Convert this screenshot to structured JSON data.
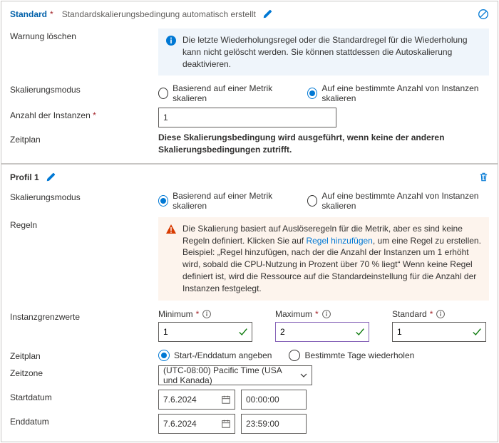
{
  "colors": {
    "accent": "#0078d4",
    "danger": "#a4262c",
    "warn": "#d83b01",
    "info_bg": "#eff5fb",
    "warn_bg": "#fdf4ed",
    "purple_focus": "#8764b8",
    "green": "#107c10"
  },
  "card1": {
    "title": "Standard",
    "subtitle": "Standardskalierungsbedingung automatisch erstellt",
    "delete_warning_label": "Warnung löschen",
    "delete_warning_text": "Die letzte Wiederholungsregel oder die Standardregel für die Wiederholung kann nicht gelöscht werden. Sie können stattdessen die Autoskalierung deaktivieren.",
    "scaling_mode_label": "Skalierungsmodus",
    "radio_metric": "Basierend auf einer Metrik skalieren",
    "radio_count": "Auf eine bestimmte Anzahl von Instanzen skalieren",
    "instance_count_label": "Anzahl der Instanzen",
    "instance_count_value": "1",
    "schedule_label": "Zeitplan",
    "schedule_text": "Diese Skalierungsbedingung wird ausgeführt, wenn keine der anderen Skalierungsbedingungen zutrifft."
  },
  "card2": {
    "title": "Profil 1",
    "scaling_mode_label": "Skalierungsmodus",
    "radio_metric": "Basierend auf einer Metrik skalieren",
    "radio_count": "Auf eine bestimmte Anzahl von Instanzen skalieren",
    "rules_label": "Regeln",
    "rules_warn_pre": "Die Skalierung basiert auf Auslöseregeln für die Metrik, aber es sind keine Regeln definiert. Klicken Sie auf ",
    "rules_warn_link": "Regel hinzufügen",
    "rules_warn_post": ", um eine Regel zu erstellen. Beispiel: „Regel hinzufügen, nach der die Anzahl der Instanzen um 1 erhöht wird, sobald die CPU-Nutzung in Prozent über 70 % liegt“ Wenn keine Regel definiert ist, wird die Ressource auf die Standardeinstellung für die Anzahl der Instanzen festgelegt.",
    "limits_label": "Instanzgrenzwerte",
    "min_label": "Minimum",
    "min_value": "1",
    "max_label": "Maximum",
    "max_value": "2",
    "def_label": "Standard",
    "def_value": "1",
    "schedule_label": "Zeitplan",
    "radio_schedule_range": "Start-/Enddatum angeben",
    "radio_schedule_repeat": "Bestimmte Tage wiederholen",
    "timezone_label": "Zeitzone",
    "timezone_value": "(UTC-08:00) Pacific Time (USA und Kanada)",
    "start_label": "Startdatum",
    "start_date": "7.6.2024",
    "start_time": "00:00:00",
    "end_label": "Enddatum",
    "end_date": "7.6.2024",
    "end_time": "23:59:00"
  }
}
